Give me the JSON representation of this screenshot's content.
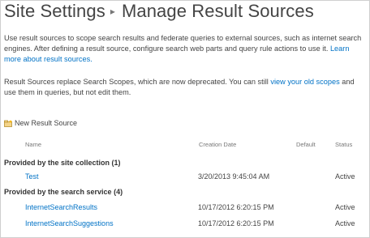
{
  "title": {
    "parent": "Site Settings",
    "current": "Manage Result Sources"
  },
  "intro": {
    "text_1": "Use result sources to scope search results and federate queries to external sources, such as internet search engines. After defining a result source, configure search web parts and query rule actions to use it. ",
    "learn_more_link": "Learn more about result sources.",
    "text_2": "Result Sources replace Search Scopes, which are now deprecated. You can still ",
    "old_scopes_link": "view your old scopes",
    "text_3": " and use them in queries, but not edit them."
  },
  "toolbar": {
    "new_result_source_label": "New Result Source",
    "new_icon": "new-item-icon"
  },
  "table": {
    "columns": [
      "Name",
      "Creation Date",
      "Default",
      "Status"
    ],
    "groups": [
      {
        "label": "Provided by the site collection (1)",
        "rows": [
          {
            "name": "Test",
            "creation_date": "3/20/2013 9:45:04 AM",
            "default": "",
            "status": "Active"
          }
        ]
      },
      {
        "label": "Provided by the search service (4)",
        "rows": [
          {
            "name": "InternetSearchResults",
            "creation_date": "10/17/2012 6:20:15 PM",
            "default": "",
            "status": "Active"
          },
          {
            "name": "InternetSearchSuggestions",
            "creation_date": "10/17/2012 6:20:15 PM",
            "default": "",
            "status": "Active"
          }
        ]
      }
    ]
  },
  "colors": {
    "link": "#0072c6",
    "text": "#444444",
    "header_text": "#777777"
  }
}
